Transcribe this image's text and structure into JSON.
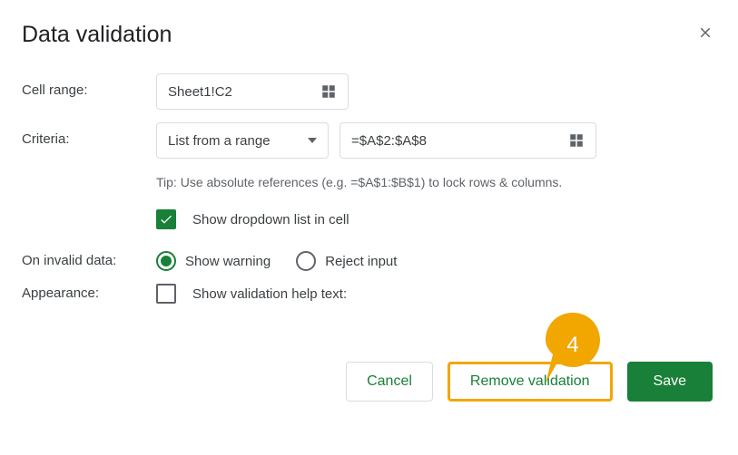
{
  "dialog": {
    "title": "Data validation"
  },
  "labels": {
    "cell_range": "Cell range:",
    "criteria": "Criteria:",
    "on_invalid": "On invalid data:",
    "appearance": "Appearance:"
  },
  "cell_range": {
    "value": "Sheet1!C2"
  },
  "criteria": {
    "type": "List from a range",
    "range": "=$A$2:$A$8",
    "tip": "Tip: Use absolute references (e.g. =$A$1:$B$1) to lock rows & columns."
  },
  "options": {
    "show_dropdown": "Show dropdown list in cell",
    "show_warning": "Show warning",
    "reject_input": "Reject input",
    "help_text": "Show validation help text:"
  },
  "buttons": {
    "cancel": "Cancel",
    "remove": "Remove validation",
    "save": "Save"
  },
  "callout": {
    "number": "4"
  }
}
